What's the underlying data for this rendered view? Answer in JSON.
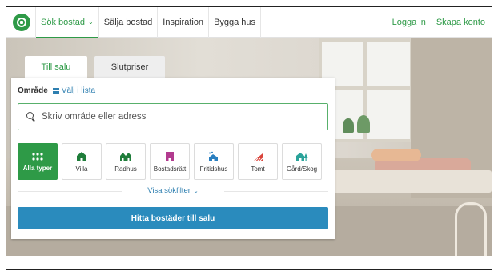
{
  "nav": {
    "items": [
      {
        "label": "Sök bostad",
        "active": true
      },
      {
        "label": "Sälja bostad"
      },
      {
        "label": "Inspiration"
      },
      {
        "label": "Bygga hus"
      }
    ],
    "chevron": "chevron-down-icon",
    "login": "Logga in",
    "signup": "Skapa konto",
    "brand_color": "#2e9a47"
  },
  "tabs": [
    {
      "label": "Till salu",
      "active": true
    },
    {
      "label": "Slutpriser"
    }
  ],
  "area": {
    "label": "Område",
    "list_link": "Välj i lista"
  },
  "search": {
    "placeholder": "Skriv område eller adress",
    "value": ""
  },
  "types": [
    {
      "label": "Alla typer",
      "icon": "grid-icon",
      "selected": true
    },
    {
      "label": "Villa",
      "icon": "villa-icon"
    },
    {
      "label": "Radhus",
      "icon": "radhus-icon"
    },
    {
      "label": "Bostadsrätt",
      "icon": "bostadsratt-icon"
    },
    {
      "label": "Fritidshus",
      "icon": "fritidshus-icon"
    },
    {
      "label": "Tomt",
      "icon": "tomt-icon"
    },
    {
      "label": "Gård/Skog",
      "icon": "gard-skog-icon"
    }
  ],
  "filter": {
    "label": "Visa sökfilter"
  },
  "cta": {
    "label": "Hitta bostäder till salu",
    "color": "#2a8bbd"
  }
}
